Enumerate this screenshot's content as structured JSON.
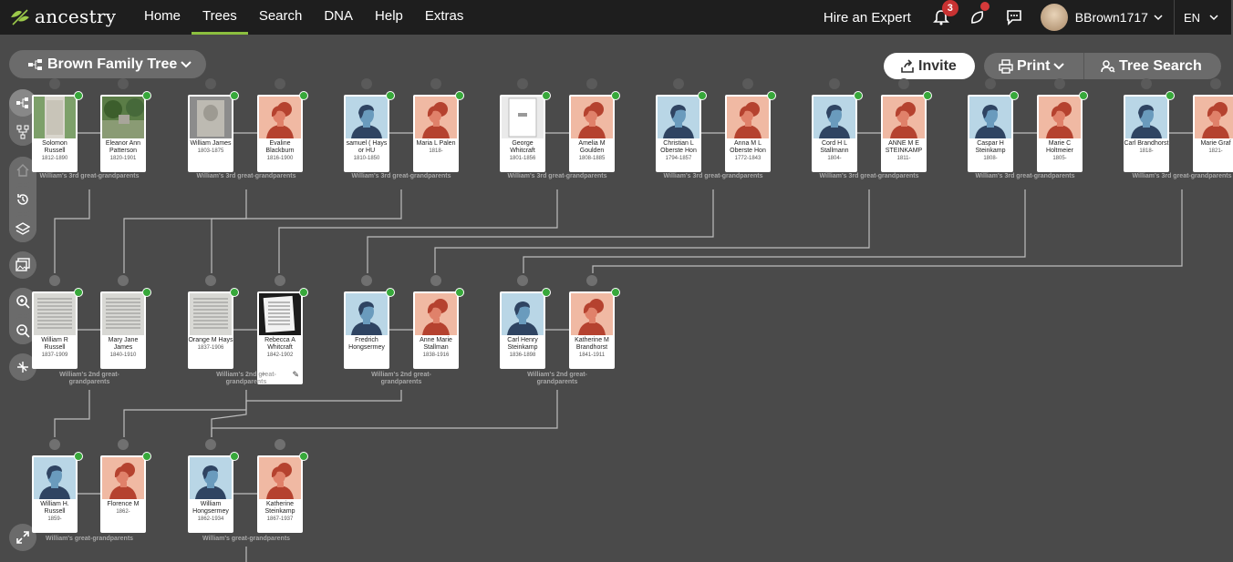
{
  "brand": {
    "name": "ancestry"
  },
  "nav": {
    "items": [
      "Home",
      "Trees",
      "Search",
      "DNA",
      "Help",
      "Extras"
    ],
    "active": "Trees"
  },
  "header": {
    "hire": "Hire an Expert",
    "notifications": "3",
    "username": "BBrown1717",
    "lang": "EN"
  },
  "toolbar": {
    "tree_name": "Brown Family Tree",
    "invite": "Invite",
    "print": "Print",
    "tree_search": "Tree Search"
  },
  "labels": {
    "g3": "William's 3rd great-grandparents",
    "g2": "William's 2nd great-grandparents",
    "g1": "William's great-grandparents"
  },
  "people": {
    "p1": {
      "name": "Solomon Russell",
      "dates": "1812-1890"
    },
    "p2": {
      "name": "Eleanor Ann Patterson",
      "dates": "1820-1901"
    },
    "p3": {
      "name": "William James",
      "dates": "1803-1875"
    },
    "p4": {
      "name": "Evaline Blackburn",
      "dates": "1816-1900"
    },
    "p5": {
      "name": "samuel ( Hays or HU",
      "dates": "1810-1850"
    },
    "p6": {
      "name": "Maria L Palen",
      "dates": "1818-"
    },
    "p7": {
      "name": "George Whitcraft",
      "dates": "1801-1856"
    },
    "p8": {
      "name": "Amelia M Goulden",
      "dates": "1808-1885"
    },
    "p9": {
      "name": "Christian L Oberste Hon",
      "dates": "1794-1857"
    },
    "p10": {
      "name": "Anna M L Oberste Hon",
      "dates": "1772-1843"
    },
    "p11": {
      "name": "Cord H L Stallmann",
      "dates": "1804-"
    },
    "p12": {
      "name": "ANNE M E STEINKAMP",
      "dates": "1811-"
    },
    "p13": {
      "name": "Caspar H Steinkamp",
      "dates": "1808-"
    },
    "p14": {
      "name": "Marie C Holtmeier",
      "dates": "1805-"
    },
    "p15": {
      "name": "Carl Brandhorst",
      "dates": "1818-"
    },
    "p16": {
      "name": "Marie Graf",
      "dates": "1821-"
    },
    "q1": {
      "name": "William R Russell",
      "dates": "1837-1909"
    },
    "q2": {
      "name": "Mary Jane James",
      "dates": "1840-1910"
    },
    "q3": {
      "name": "Orange M Hays",
      "dates": "1837-1906"
    },
    "q4": {
      "name": "Rebecca A Whitcraft",
      "dates": "1842-1902"
    },
    "q5": {
      "name": "Fredrich Hongsermey",
      "dates": ""
    },
    "q6": {
      "name": "Anne Marie Stallman",
      "dates": "1838-1916"
    },
    "q7": {
      "name": "Carl Henry Steinkamp",
      "dates": "1836-1898"
    },
    "q8": {
      "name": "Katherine M Brandhorst",
      "dates": "1841-1911"
    },
    "r1": {
      "name": "William H. Russell",
      "dates": "1859-"
    },
    "r2": {
      "name": "Florence M",
      "dates": "1862-"
    },
    "r3": {
      "name": "William Hongsermey",
      "dates": "1862-1934"
    },
    "r4": {
      "name": "Katherine Steinkamp",
      "dates": "1867-1937"
    }
  }
}
